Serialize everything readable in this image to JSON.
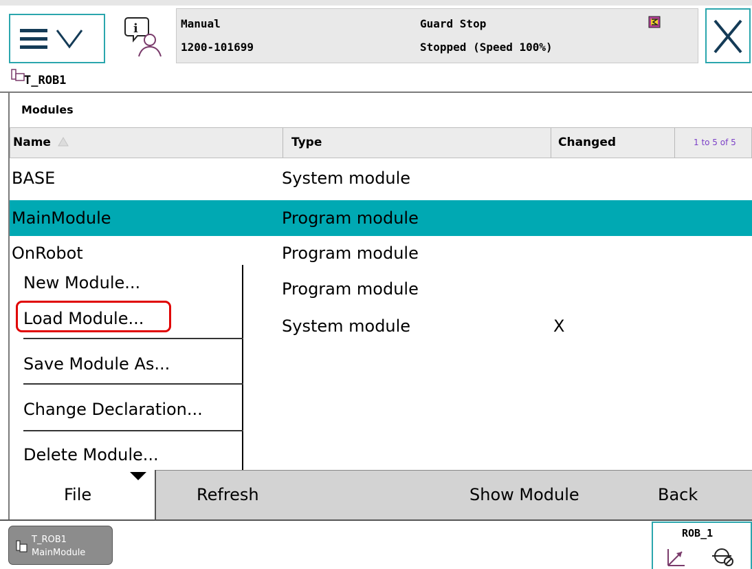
{
  "status": {
    "mode": "Manual",
    "system_id": "1200-101699",
    "state": "Guard Stop",
    "speed_state": "Stopped (Speed 100%)"
  },
  "task_tab": "T_ROB1",
  "modules": {
    "title": "Modules",
    "columns": [
      "Name",
      "Type",
      "Changed"
    ],
    "count_label": "1 to 5 of 5",
    "rows": [
      {
        "name": "BASE",
        "type": "System module",
        "changed": ""
      },
      {
        "name": "MainModule",
        "type": "Program module",
        "changed": ""
      },
      {
        "name": "OnRobot",
        "type": "Program module",
        "changed": ""
      },
      {
        "name": "",
        "type": "Program module",
        "changed": ""
      },
      {
        "name": "",
        "type": "System module",
        "changed": "X"
      }
    ],
    "selected_index": 1
  },
  "file_menu": {
    "items": [
      "New Module...",
      "Load Module...",
      "Save Module As...",
      "Change Declaration...",
      "Delete Module..."
    ],
    "highlighted": "Load Module..."
  },
  "command_bar": {
    "file": "File",
    "refresh": "Refresh",
    "show_module": "Show Module",
    "back": "Back"
  },
  "footer": {
    "task_line1": "T_ROB1",
    "task_line2": "MainModule",
    "mech_unit": "ROB_1"
  },
  "icons": [
    "hamburger-icon",
    "chevron-down-icon",
    "info-person-icon",
    "operator-window-icon",
    "close-icon",
    "task-icon",
    "sort-ascending-icon",
    "dropdown-caret-icon",
    "coordinate-frame-icon",
    "tool-icon"
  ],
  "colors": {
    "accent": "#2aa6ad",
    "selection": "#00a9b3",
    "highlight": "#e00000"
  }
}
